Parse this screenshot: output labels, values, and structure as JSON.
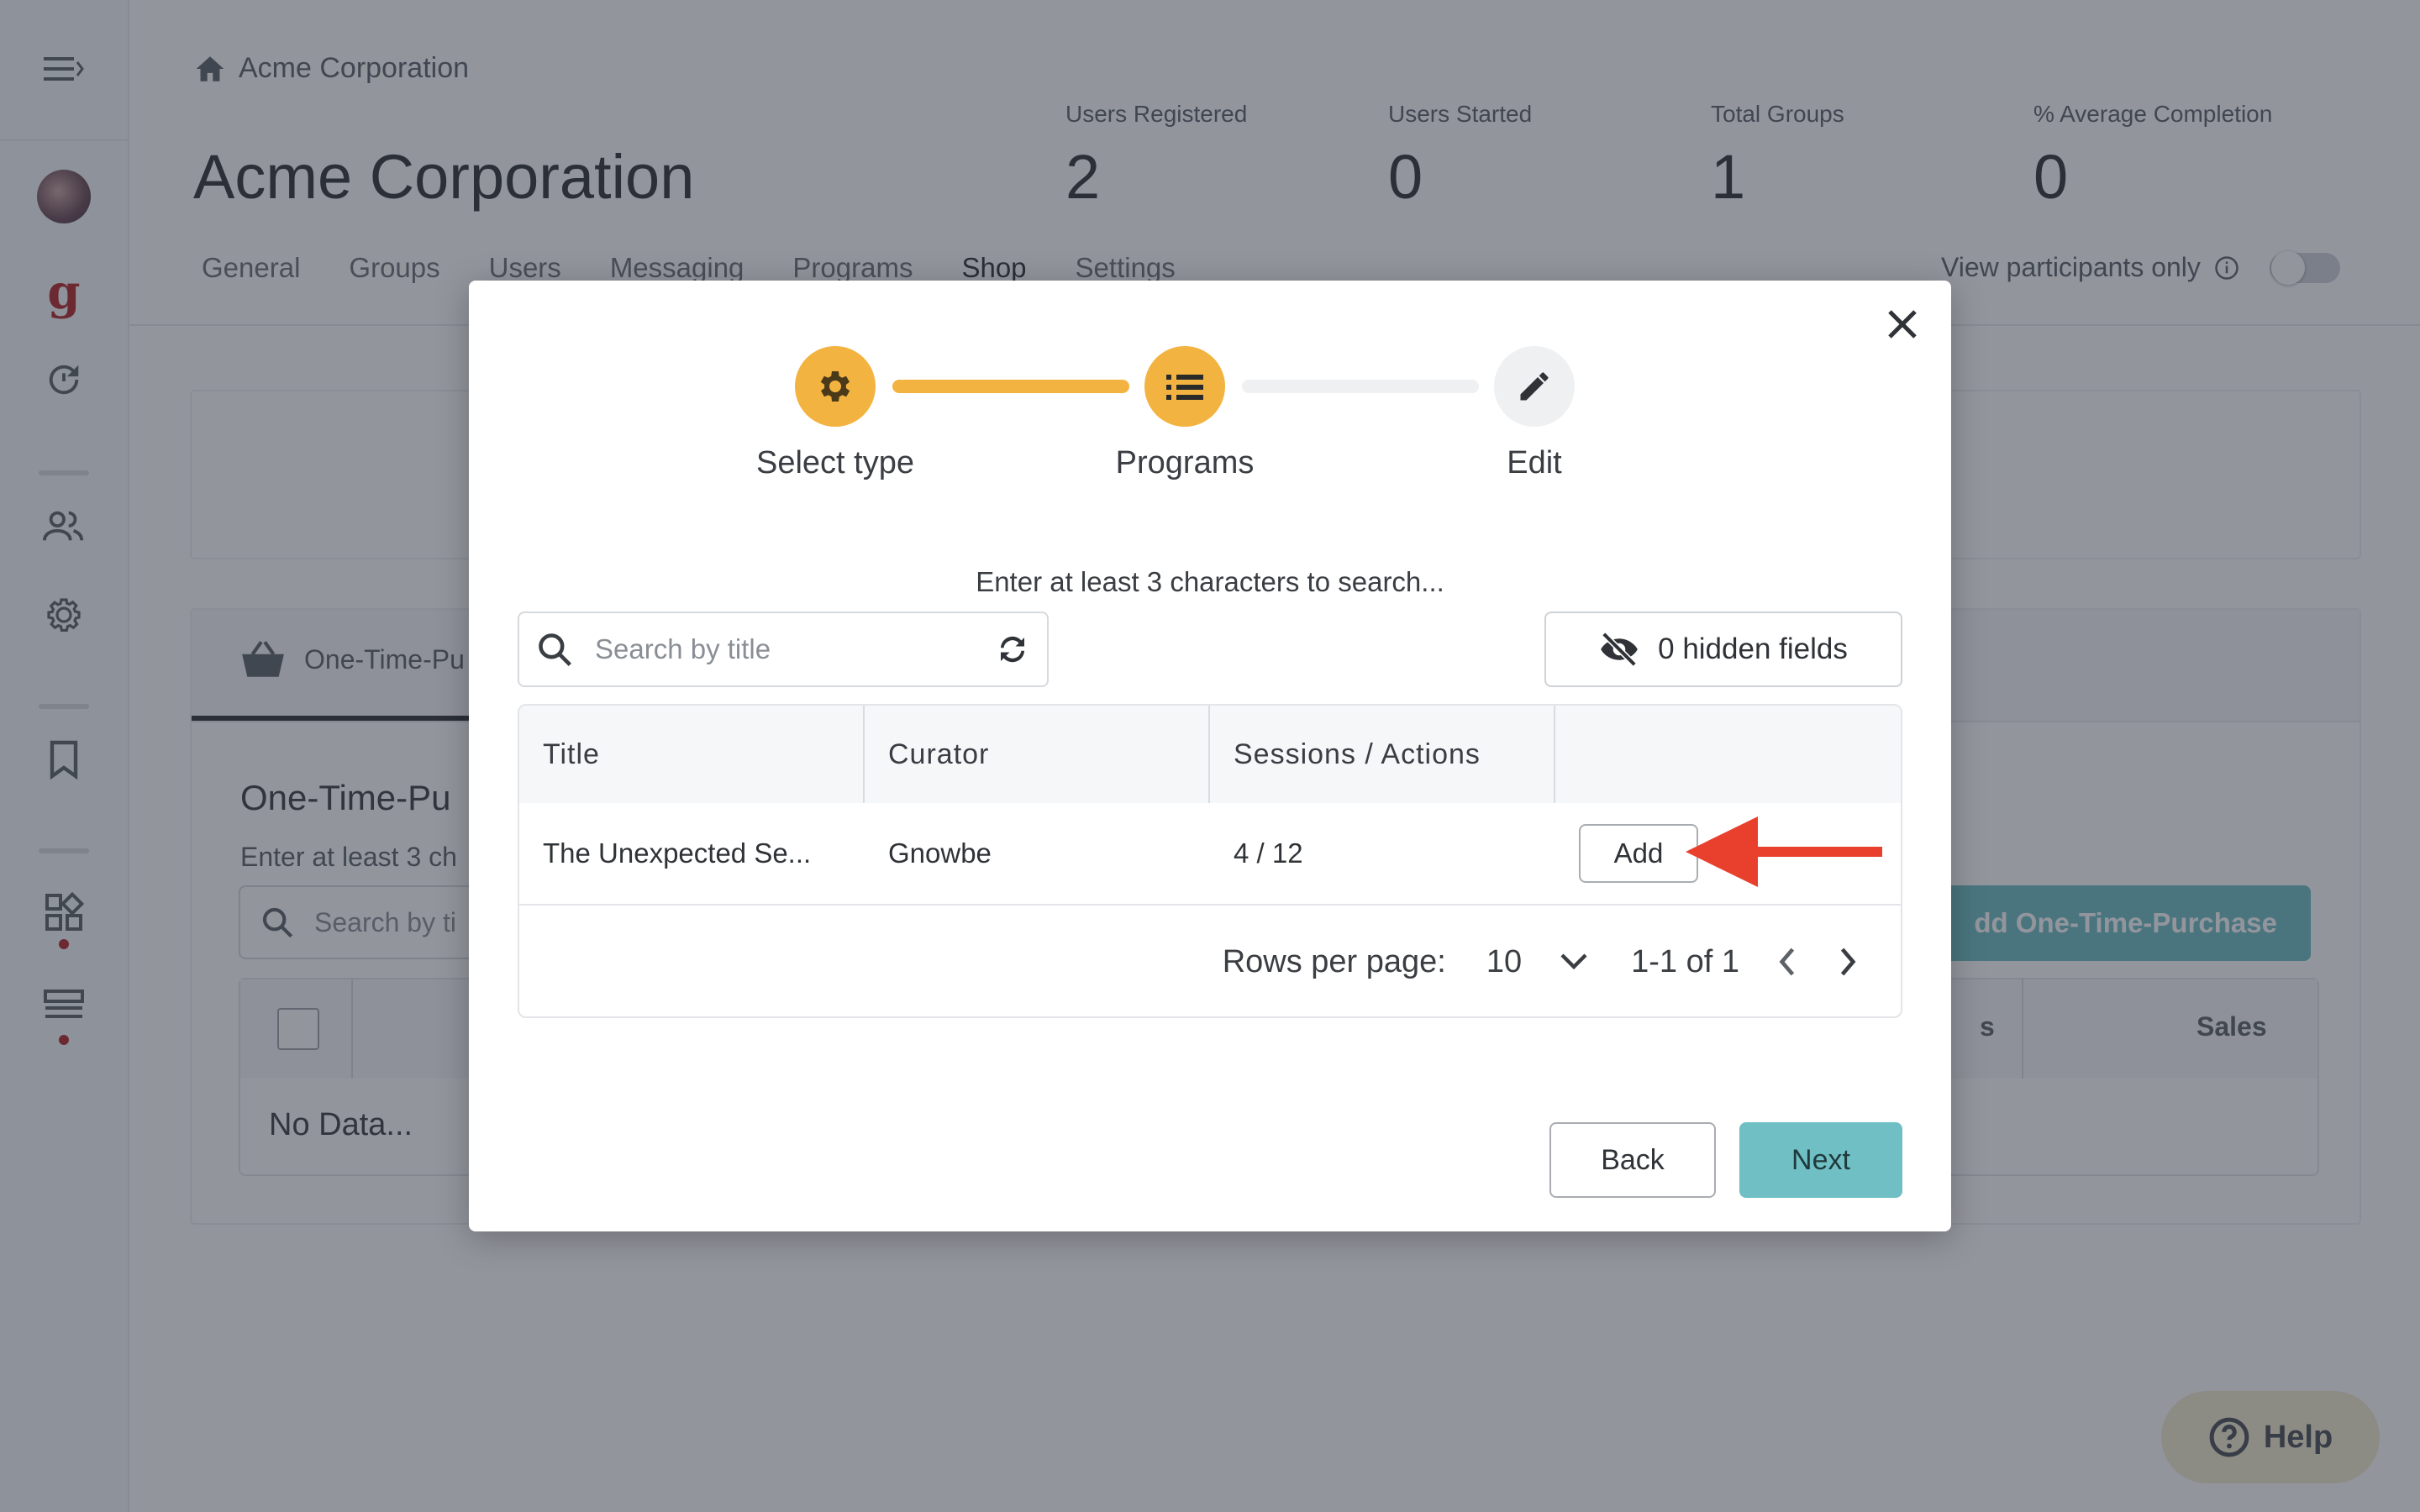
{
  "header": {
    "breadcrumb": "Acme Corporation",
    "title": "Acme Corporation",
    "stats": [
      {
        "label": "Users Registered",
        "value": "2"
      },
      {
        "label": "Users Started",
        "value": "0"
      },
      {
        "label": "Total Groups",
        "value": "1"
      },
      {
        "label": "% Average Completion",
        "value": "0"
      }
    ],
    "tabs": [
      "General",
      "Groups",
      "Users",
      "Messaging",
      "Programs",
      "Shop",
      "Settings"
    ],
    "active_tab": "Shop",
    "view_participants_label": "View participants only"
  },
  "background": {
    "card_tab_label": "One-Time-Pu",
    "section_title": "One-Time-Pu",
    "section_hint": "Enter at least 3 ch",
    "search_placeholder": "Search by ti",
    "add_button": "dd One-Time-Purchase",
    "col_partial": "s",
    "col_sales": "Sales",
    "no_data": "No Data..."
  },
  "modal": {
    "steps": [
      {
        "label": "Select type",
        "icon": "gear-icon",
        "state": "done"
      },
      {
        "label": "Programs",
        "icon": "list-icon",
        "state": "active"
      },
      {
        "label": "Edit",
        "icon": "pencil-icon",
        "state": "pending"
      }
    ],
    "hint": "Enter at least 3 characters to search...",
    "search_placeholder": "Search by title",
    "hidden_fields_label": "0 hidden fields",
    "table": {
      "columns": [
        "Title",
        "Curator",
        "Sessions / Actions",
        ""
      ],
      "rows": [
        {
          "title": "The Unexpected Se...",
          "curator": "Gnowbe",
          "sessions": "4 / 12",
          "action": "Add"
        }
      ]
    },
    "pagination": {
      "rows_per_page_label": "Rows per page:",
      "rows_per_page": "10",
      "range": "1-1 of 1"
    },
    "back_label": "Back",
    "next_label": "Next"
  },
  "help_label": "Help",
  "colors": {
    "accent": "#f3b340",
    "teal": "#6fbfc4",
    "annotation_arrow": "#e8402d"
  }
}
